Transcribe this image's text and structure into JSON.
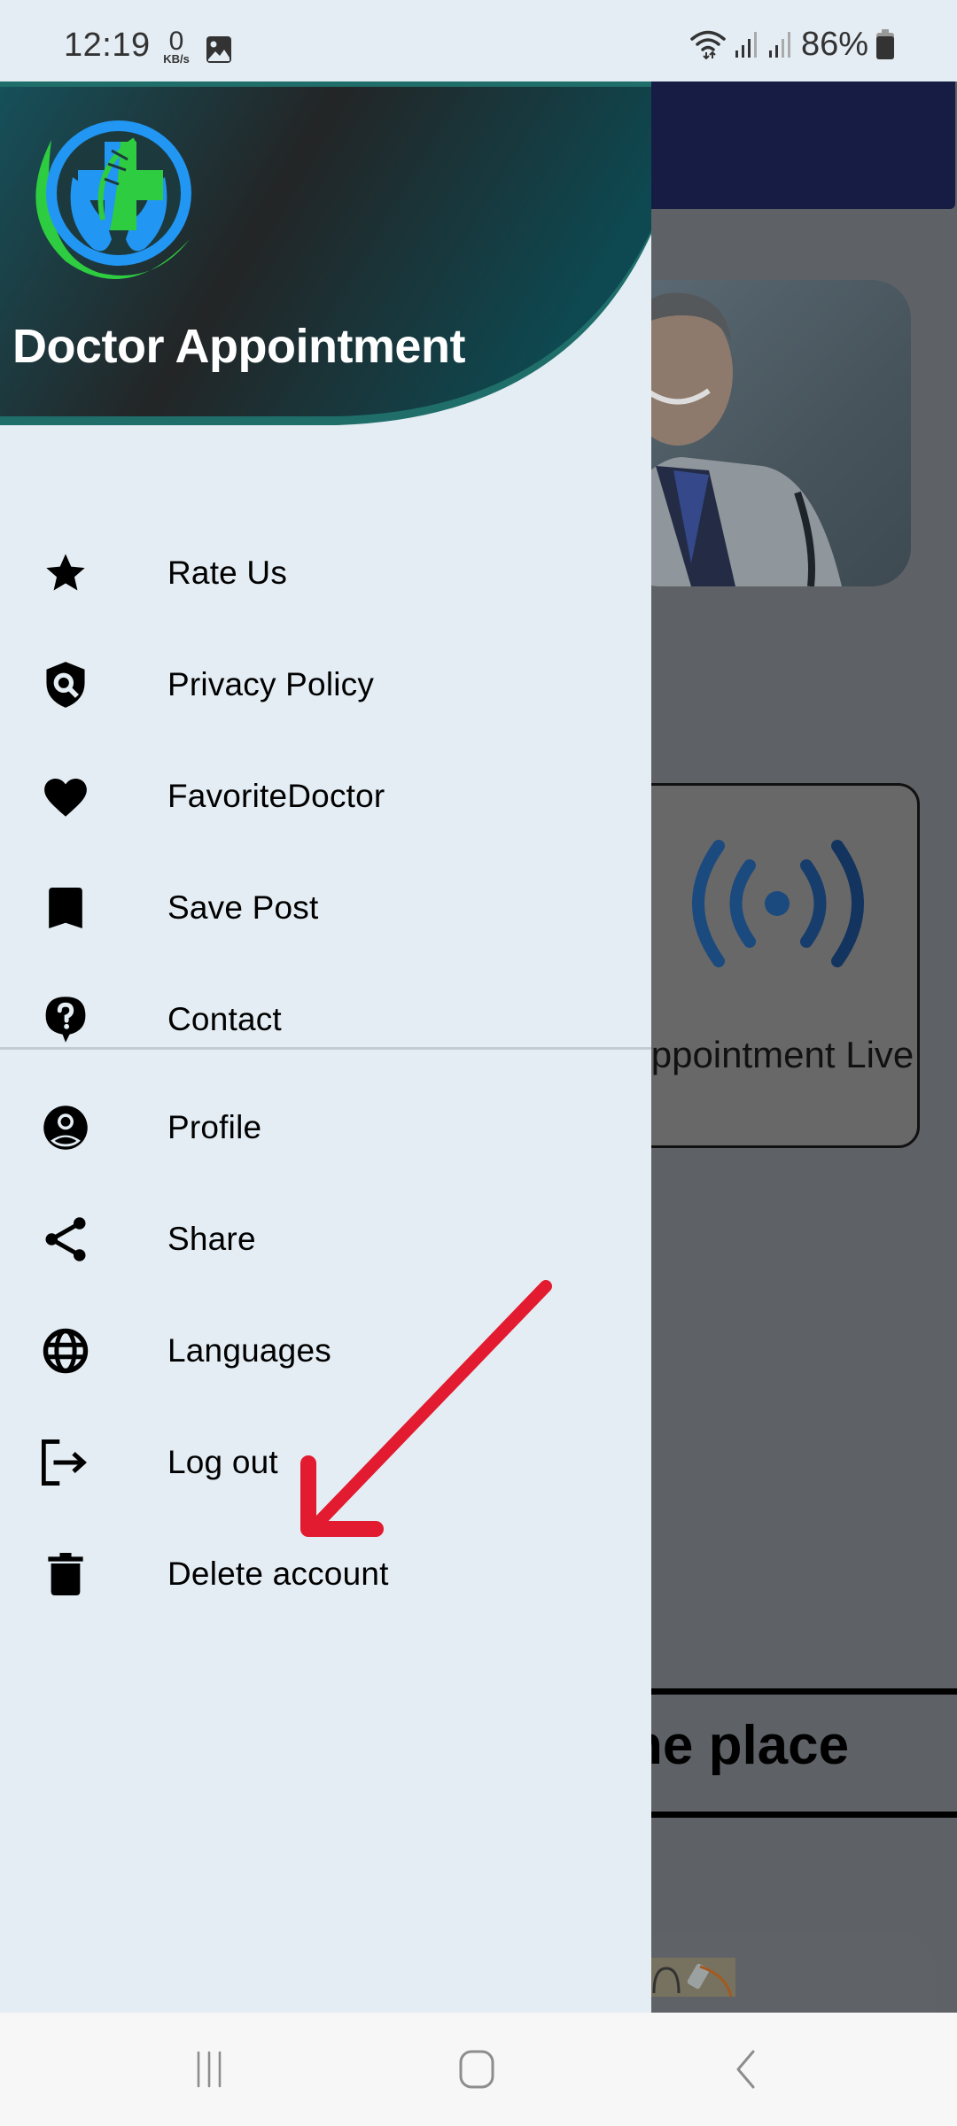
{
  "status_bar": {
    "time": "12:19",
    "net_speed_value": "0",
    "net_speed_unit": "KB/s",
    "battery_percent": "86%",
    "icons": [
      "gallery-icon",
      "wifi-icon",
      "signal-icon",
      "signal-icon",
      "battery-icon"
    ]
  },
  "drawer": {
    "app_title": "Doctor Appointment",
    "logo": "doctor-appointment-logo",
    "menu_primary": [
      {
        "label": "Rate Us",
        "icon": "star-icon"
      },
      {
        "label": "Privacy Policy",
        "icon": "shield-search-icon"
      },
      {
        "label": "FavoriteDoctor",
        "icon": "heart-icon"
      },
      {
        "label": "Save Post",
        "icon": "bookmark-icon"
      },
      {
        "label": "Contact",
        "icon": "help-bubble-icon"
      }
    ],
    "menu_secondary": [
      {
        "label": "Profile",
        "icon": "account-circle-icon"
      },
      {
        "label": "Share",
        "icon": "share-icon"
      },
      {
        "label": "Languages",
        "icon": "globe-icon"
      },
      {
        "label": "Log out",
        "icon": "logout-icon"
      },
      {
        "label": "Delete account",
        "icon": "trash-icon"
      }
    ]
  },
  "background_app": {
    "live_card_label": "Appointment Live",
    "banner_text": "ne place"
  },
  "annotation": {
    "type": "arrow",
    "points_to": "Delete account",
    "color": "#e21b30"
  },
  "colors": {
    "drawer_bg": "#e4edf3",
    "header_dark": "#1d2528",
    "header_teal": "#1f6e6a",
    "logo_blue": "#2196f3",
    "logo_green": "#2ecc40",
    "live_icon_blue": "#1b4f86"
  },
  "nav_bar": {
    "buttons": [
      "recent-apps",
      "home",
      "back"
    ]
  }
}
